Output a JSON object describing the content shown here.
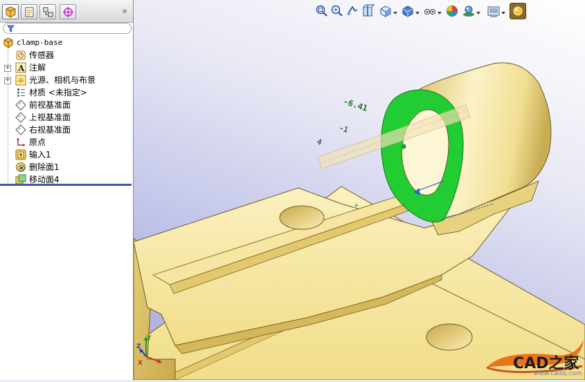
{
  "panel": {
    "tabs": [
      {
        "name": "featuremanager-tab",
        "icon": "feature-tree-icon",
        "active": true
      },
      {
        "name": "propertymanager-tab",
        "icon": "property-icon",
        "active": false
      },
      {
        "name": "configurationmanager-tab",
        "icon": "configuration-icon",
        "active": false
      },
      {
        "name": "dimxpert-tab",
        "icon": "crosshair-icon",
        "active": false
      }
    ],
    "collapse_glyph": "»",
    "filter_icon": "filter-icon",
    "tree": {
      "root": {
        "label": "clamp-base",
        "icon": "part-icon"
      },
      "items": [
        {
          "label": "传感器",
          "icon": "sensor-icon",
          "expandable": false
        },
        {
          "label": "注解",
          "icon": "annotation-icon",
          "expandable": true
        },
        {
          "label": "光源、相机与布景",
          "icon": "lights-icon",
          "expandable": true
        },
        {
          "label": "材质 <未指定>",
          "icon": "material-icon",
          "expandable": false
        },
        {
          "label": "前视基准面",
          "icon": "plane-icon",
          "expandable": false
        },
        {
          "label": "上视基准面",
          "icon": "plane-icon",
          "expandable": false
        },
        {
          "label": "右视基准面",
          "icon": "plane-icon",
          "expandable": false
        },
        {
          "label": "原点",
          "icon": "origin-icon",
          "expandable": false
        },
        {
          "label": "输入1",
          "icon": "import-icon",
          "expandable": false
        },
        {
          "label": "删除面1",
          "icon": "delete-face-icon",
          "expandable": false
        },
        {
          "label": "移动面4",
          "icon": "move-face-icon",
          "expandable": false
        }
      ]
    }
  },
  "viewport": {
    "headsup_toolbar": [
      {
        "name": "zoom-to-fit-icon",
        "dropdown": false
      },
      {
        "name": "zoom-to-area-icon",
        "dropdown": false
      },
      {
        "name": "previous-view-icon",
        "dropdown": false
      },
      {
        "name": "section-view-icon",
        "dropdown": false
      },
      {
        "name": "view-orientation-icon",
        "dropdown": true
      },
      {
        "name": "display-style-icon",
        "dropdown": true
      },
      {
        "name": "hide-show-items-icon",
        "dropdown": true
      },
      {
        "name": "edit-appearance-icon",
        "dropdown": false
      },
      {
        "name": "apply-scene-icon",
        "dropdown": true
      },
      {
        "name": "view-settings-icon",
        "dropdown": true
      },
      {
        "name": "render-tools-icon",
        "dropdown": false
      }
    ],
    "ruler_labels": [
      "-6.41",
      "-1",
      "4"
    ],
    "triad_axes": [
      "X",
      "Y",
      "Z"
    ]
  },
  "watermark": {
    "text": "CAD之家",
    "url": "www.cadzj.com"
  },
  "colors": {
    "model_face": "#f7eaa0",
    "model_shadow": "#d8c06a",
    "selected_face": "#22cc33",
    "viewport_top": "#ffffff",
    "viewport_bottom": "#a9addd",
    "rollback_bar": "#3b5aa8"
  }
}
